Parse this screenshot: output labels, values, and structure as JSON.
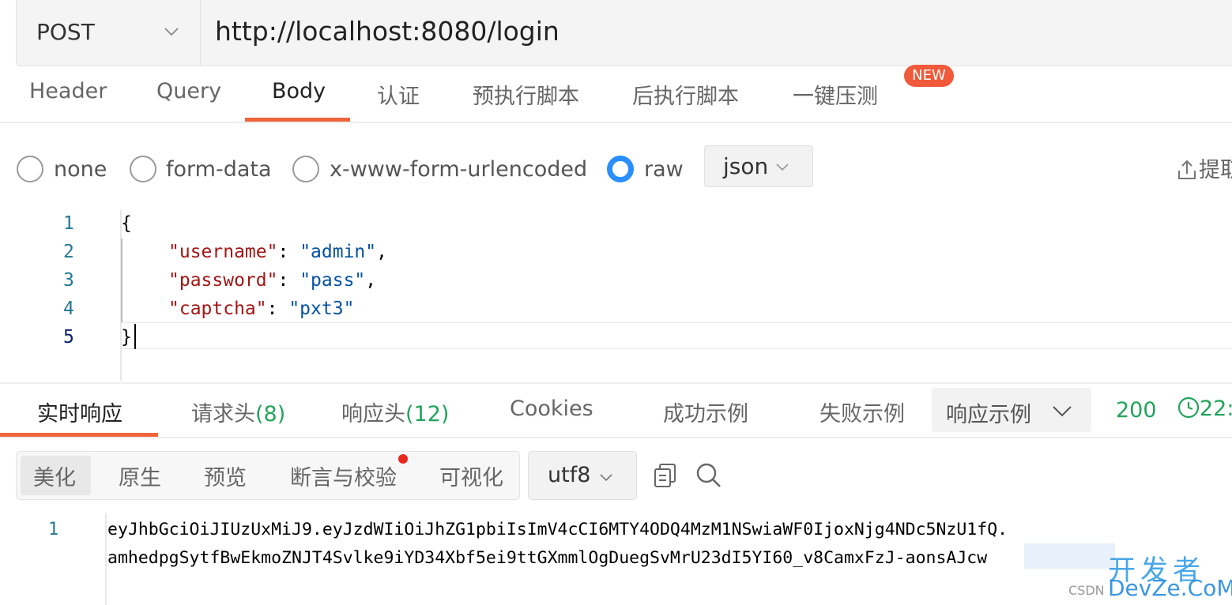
{
  "request": {
    "method": "POST",
    "url": "http://localhost:8080/login"
  },
  "request_tabs": [
    {
      "label": "Header"
    },
    {
      "label": "Query"
    },
    {
      "label": "Body",
      "active": true
    },
    {
      "label": "认证"
    },
    {
      "label": "预执行脚本"
    },
    {
      "label": "后执行脚本"
    },
    {
      "label": "一键压测",
      "badge": "NEW"
    }
  ],
  "body_types": [
    {
      "label": "none",
      "checked": false
    },
    {
      "label": "form-data",
      "checked": false
    },
    {
      "label": "x-www-form-urlencoded",
      "checked": false
    },
    {
      "label": "raw",
      "checked": true
    }
  ],
  "body_format": "json",
  "extract_label": "提取",
  "code": {
    "line_numbers": [
      "1",
      "2",
      "3",
      "4",
      "5"
    ],
    "open_brace": "{",
    "close_brace": "}",
    "fields": [
      {
        "key": "\"username\"",
        "value": "\"admin\"",
        "trailing": ","
      },
      {
        "key": "\"password\"",
        "value": "\"pass\"",
        "trailing": ","
      },
      {
        "key": "\"captcha\"",
        "value": "\"pxt3\"",
        "trailing": ""
      }
    ]
  },
  "response_tabs": [
    {
      "label": "实时响应",
      "count": "",
      "active": true
    },
    {
      "label": "请求头",
      "count": "(8)"
    },
    {
      "label": "响应头",
      "count": "(12)"
    },
    {
      "label": "Cookies",
      "count": ""
    },
    {
      "label": "成功示例",
      "count": ""
    },
    {
      "label": "失败示例",
      "count": ""
    }
  ],
  "example_select": "响应示例",
  "status_code": "200",
  "timing": "22:",
  "view_modes": [
    {
      "label": "美化",
      "active": true
    },
    {
      "label": "原生"
    },
    {
      "label": "预览"
    },
    {
      "label": "断言与校验",
      "dot": true
    },
    {
      "label": "可视化"
    }
  ],
  "encoding": "utf8",
  "response": {
    "line_number": "1",
    "lines": [
      "eyJhbGciOiJIUzUxMiJ9.eyJzdWIiOiJhZG1pbiIsImV4cCI6MTY4ODQ4MzM1NSwiaWF0IjoxNjg4NDc5NzU1fQ.",
      "amhedpgSytfBwEkmoZNJT4Svlke9iYD34Xbf5ei9ttGXmmlOgDuegSvMrU23dI5YI60_v8CamxFzJ-aonsAJcw"
    ]
  },
  "watermark": {
    "cn": "开发者",
    "en": "DevZe.CoM",
    "csdn": "CSDN"
  },
  "colors": {
    "accent": "#f0643c",
    "radio_checked": "#2b8eff",
    "success": "#22a45b",
    "json_key": "#a31515",
    "json_value": "#0451a5"
  }
}
